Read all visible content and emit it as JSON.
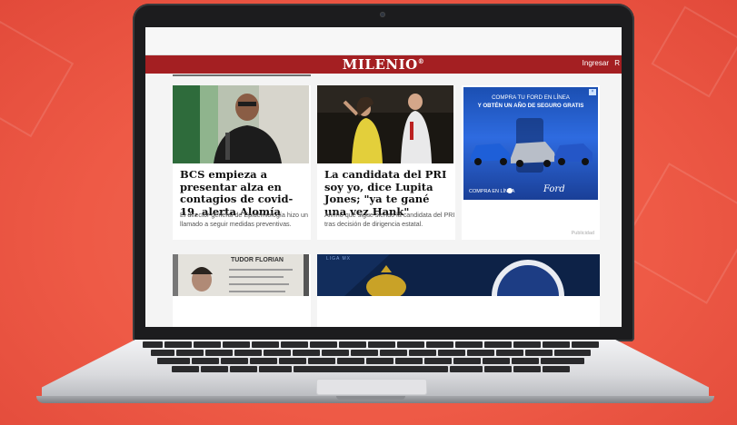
{
  "site": {
    "logo": "MILENIO",
    "logo_mark": "®",
    "login_label": "Ingresar",
    "login_label_2": "R"
  },
  "articles": [
    {
      "headline": "BCS empieza a presentar alza en contagios de covid-19, alerta Alomía",
      "summary": "El director general de Epidemiología hizo un llamado a seguir medidas preventivas."
    },
    {
      "headline": "La candidata del PRI soy yo, dice Lupita Jones; \"ya te gané una vez Hank\"",
      "summary": "Afirmó que sigue siendo la candidata del PRI tras decisión de dirigencia estatal."
    }
  ],
  "ad": {
    "line1": "COMPRA TU FORD EN LÍNEA",
    "line2": "Y OBTÉN UN AÑO DE SEGURO GRATIS",
    "cta": "COMPRA EN LÍNEA",
    "brand": "Ford",
    "label": "Publicidad",
    "close": "×"
  },
  "lower": {
    "card_name": "TUDOR FLORIAN",
    "tag": "LIGA MX"
  },
  "colors": {
    "background": "#ee5a46",
    "header": "#a41f22",
    "ad_blue": "#1b4fb2"
  }
}
